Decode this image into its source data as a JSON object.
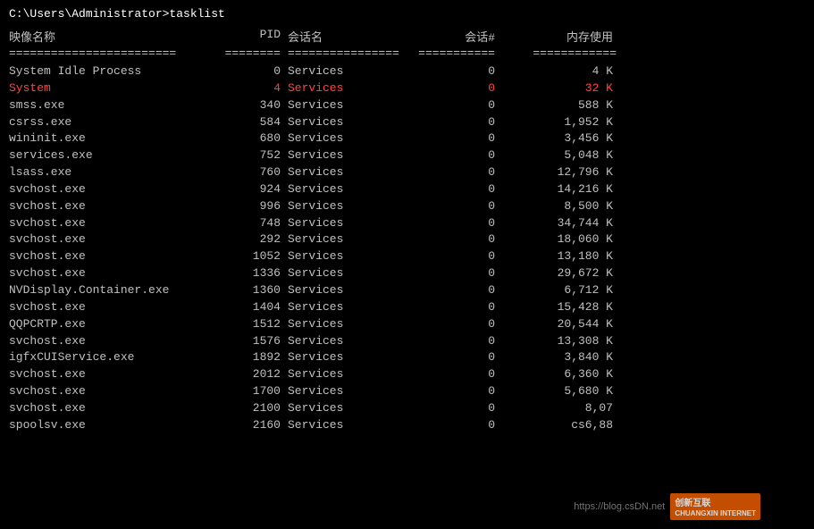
{
  "terminal": {
    "cmd_line": "C:\\Users\\Administrator>tasklist",
    "headers": {
      "name": "映像名称",
      "pid": "PID",
      "session_name": "会话名",
      "session_num": "会话#",
      "mem": "内存使用"
    },
    "separators": {
      "name": "========================",
      "pid": "========",
      "session_name": "================",
      "session_num": "===========",
      "mem": "============"
    },
    "rows": [
      {
        "name": "System Idle Process",
        "pid": "0",
        "session_name": "Services",
        "session_num": "0",
        "mem": "4 K",
        "highlight": false
      },
      {
        "name": "System",
        "pid": "4",
        "session_name": "Services",
        "session_num": "0",
        "mem": "32 K",
        "highlight": true
      },
      {
        "name": "smss.exe",
        "pid": "340",
        "session_name": "Services",
        "session_num": "0",
        "mem": "588 K",
        "highlight": false
      },
      {
        "name": "csrss.exe",
        "pid": "584",
        "session_name": "Services",
        "session_num": "0",
        "mem": "1,952 K",
        "highlight": false
      },
      {
        "name": "wininit.exe",
        "pid": "680",
        "session_name": "Services",
        "session_num": "0",
        "mem": "3,456 K",
        "highlight": false
      },
      {
        "name": "services.exe",
        "pid": "752",
        "session_name": "Services",
        "session_num": "0",
        "mem": "5,048 K",
        "highlight": false
      },
      {
        "name": "lsass.exe",
        "pid": "760",
        "session_name": "Services",
        "session_num": "0",
        "mem": "12,796 K",
        "highlight": false
      },
      {
        "name": "svchost.exe",
        "pid": "924",
        "session_name": "Services",
        "session_num": "0",
        "mem": "14,216 K",
        "highlight": false
      },
      {
        "name": "svchost.exe",
        "pid": "996",
        "session_name": "Services",
        "session_num": "0",
        "mem": "8,500 K",
        "highlight": false
      },
      {
        "name": "svchost.exe",
        "pid": "748",
        "session_name": "Services",
        "session_num": "0",
        "mem": "34,744 K",
        "highlight": false
      },
      {
        "name": "svchost.exe",
        "pid": "292",
        "session_name": "Services",
        "session_num": "0",
        "mem": "18,060 K",
        "highlight": false
      },
      {
        "name": "svchost.exe",
        "pid": "1052",
        "session_name": "Services",
        "session_num": "0",
        "mem": "13,180 K",
        "highlight": false
      },
      {
        "name": "svchost.exe",
        "pid": "1336",
        "session_name": "Services",
        "session_num": "0",
        "mem": "29,672 K",
        "highlight": false
      },
      {
        "name": "NVDisplay.Container.exe",
        "pid": "1360",
        "session_name": "Services",
        "session_num": "0",
        "mem": "6,712 K",
        "highlight": false
      },
      {
        "name": "svchost.exe",
        "pid": "1404",
        "session_name": "Services",
        "session_num": "0",
        "mem": "15,428 K",
        "highlight": false
      },
      {
        "name": "QQPCRTP.exe",
        "pid": "1512",
        "session_name": "Services",
        "session_num": "0",
        "mem": "20,544 K",
        "highlight": false
      },
      {
        "name": "svchost.exe",
        "pid": "1576",
        "session_name": "Services",
        "session_num": "0",
        "mem": "13,308 K",
        "highlight": false
      },
      {
        "name": "igfxCUIService.exe",
        "pid": "1892",
        "session_name": "Services",
        "session_num": "0",
        "mem": "3,840 K",
        "highlight": false
      },
      {
        "name": "svchost.exe",
        "pid": "2012",
        "session_name": "Services",
        "session_num": "0",
        "mem": "6,360 K",
        "highlight": false
      },
      {
        "name": "svchost.exe",
        "pid": "1700",
        "session_name": "Services",
        "session_num": "0",
        "mem": "5,680 K",
        "highlight": false
      },
      {
        "name": "svchost.exe",
        "pid": "2100",
        "session_name": "Services",
        "session_num": "0",
        "mem": "8,07",
        "highlight": false
      },
      {
        "name": "spoolsv.exe",
        "pid": "2160",
        "session_name": "Services",
        "session_num": "0",
        "mem": "cs6,88",
        "highlight": false
      }
    ]
  },
  "watermark": {
    "url": "https://blog.csDN.net",
    "logo": "创新互联",
    "sub": "CHUANGXIN INTERNET"
  }
}
